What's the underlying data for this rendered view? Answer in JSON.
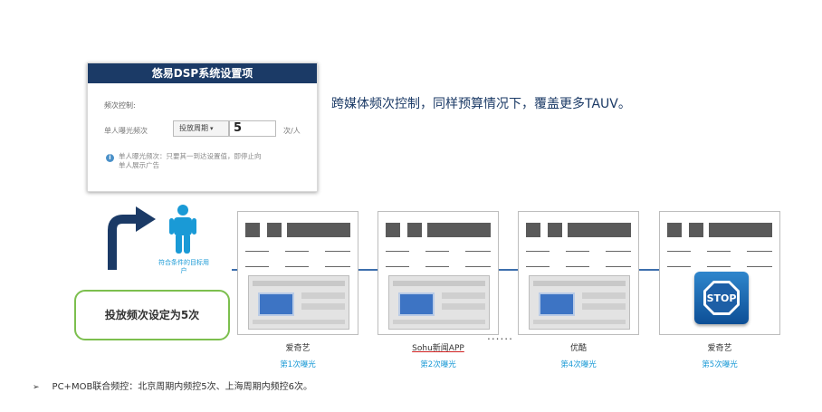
{
  "panel": {
    "title": "悠易DSP系统设置项",
    "frequency_control_label": "频次控制:",
    "per_user_label": "单人曝光频次",
    "period_select_value": "投放周期",
    "count_value": "5",
    "unit_label": "次/人",
    "info_text": "单人曝光频次：只要其一到达设置值，即停止向单人展示广告"
  },
  "headline": "跨媒体频次控制，同样预算情况下，覆盖更多TAUV。",
  "target_caption": "符合条件的目标用户",
  "callout": "投放频次设定为5次",
  "cards": [
    {
      "name": "爱奇艺",
      "impression": "第1次曝光"
    },
    {
      "name": "Sohu新闻APP",
      "impression": "第2次曝光"
    },
    {
      "name": "优酷",
      "impression": "第4次曝光"
    },
    {
      "name": "爱奇艺",
      "impression": "第5次曝光"
    }
  ],
  "stop_sign_text": "STOP",
  "ellipsis": "......",
  "footer": {
    "bullet": "➢",
    "text": "PC+MOB联合频控：北京周期内频控5次、上海周期内频控6次。"
  },
  "colors": {
    "panel_header": "#1b3a66",
    "accent_blue": "#1a9ad6",
    "callout_border": "#7cbf4e",
    "timeline": "#3d6fad"
  },
  "icons": [
    "info-icon",
    "turn-arrow-icon",
    "person-icon",
    "stop-sign-icon",
    "caret-down-icon"
  ]
}
